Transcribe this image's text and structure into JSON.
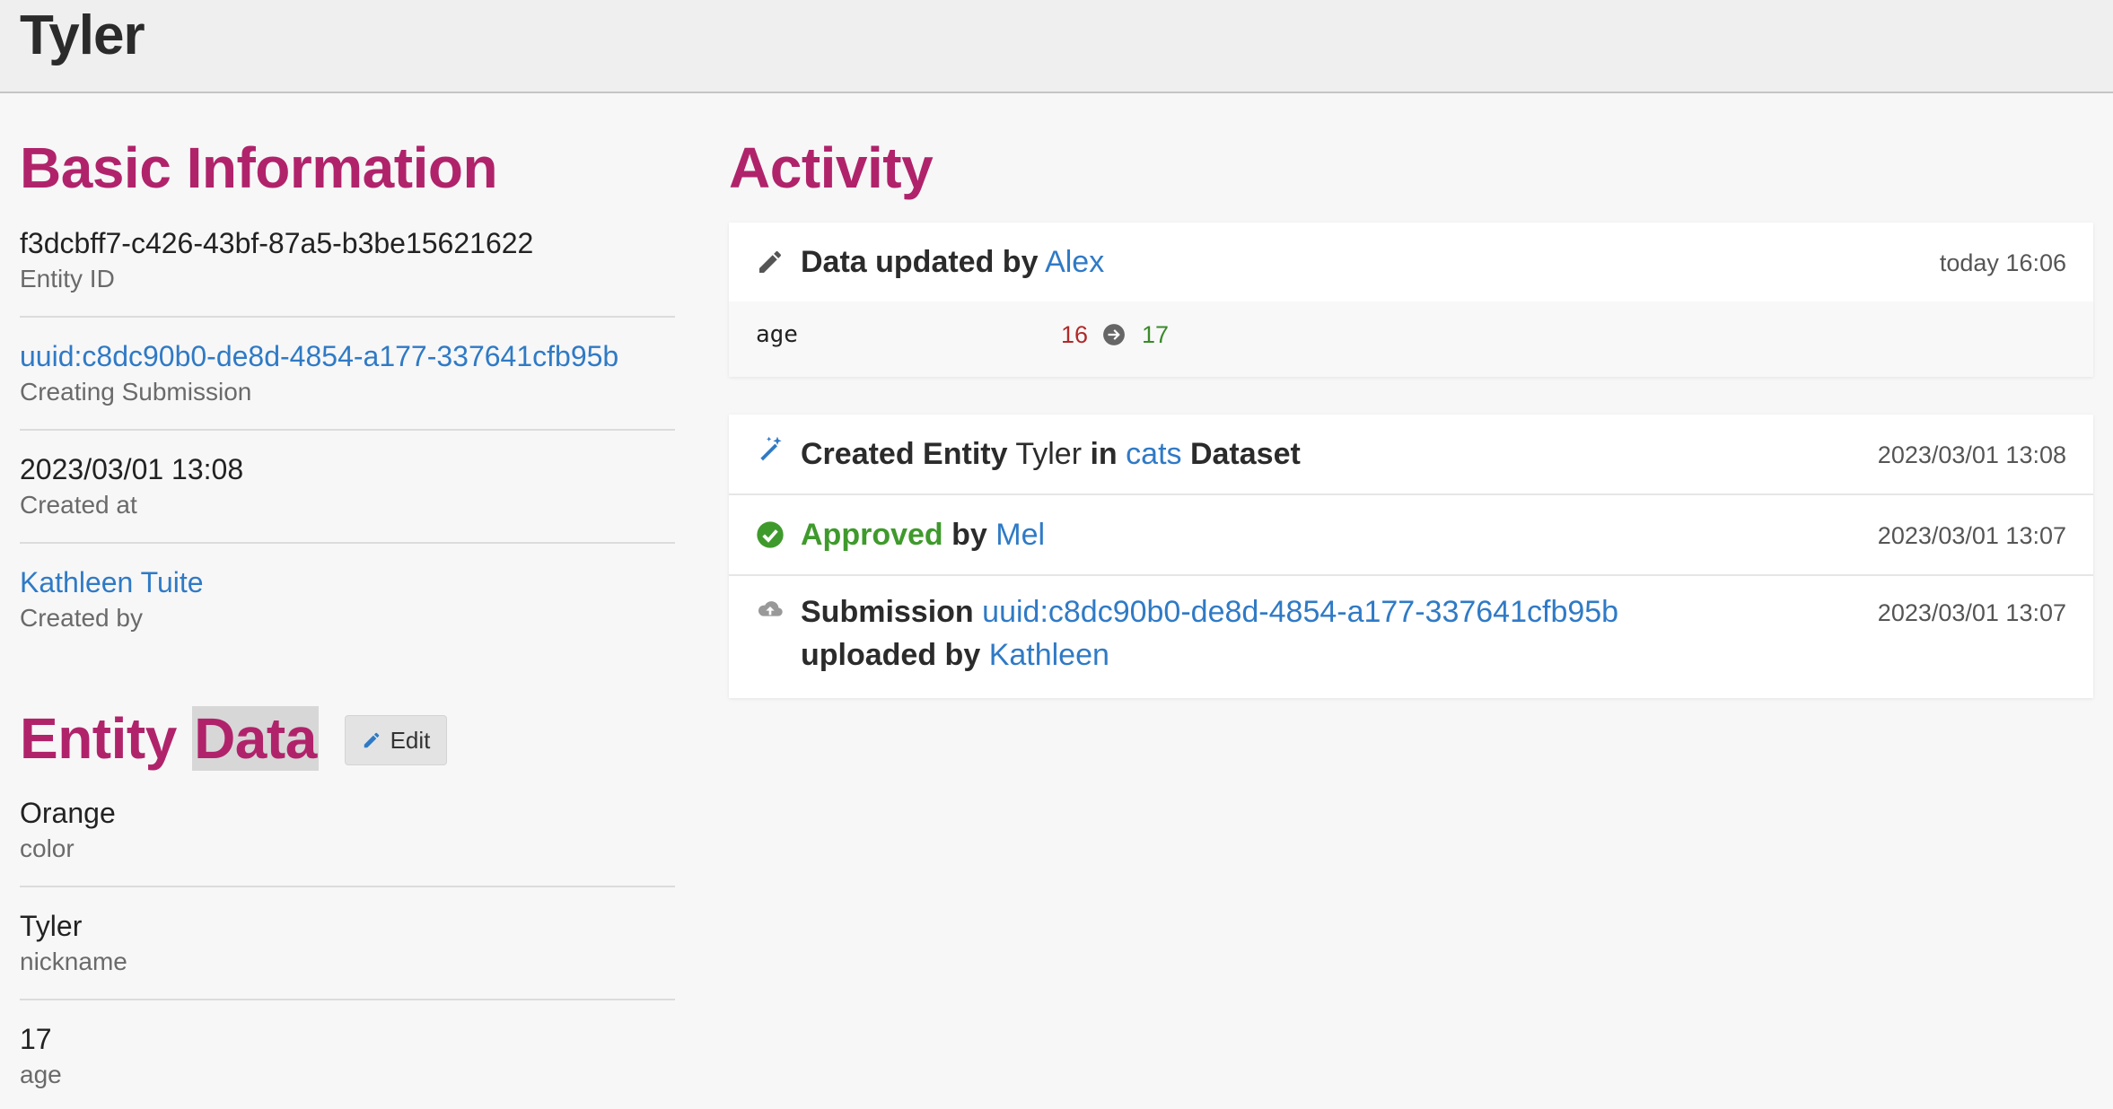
{
  "header": {
    "title": "Tyler"
  },
  "basic_info": {
    "title": "Basic Information",
    "fields": [
      {
        "value": "f3dcbff7-c426-43bf-87a5-b3be15621622",
        "label": "Entity ID"
      },
      {
        "value": "uuid:c8dc90b0-de8d-4854-a177-337641cfb95b",
        "label": "Creating Submission"
      },
      {
        "value": "2023/03/01 13:08",
        "label": "Created at"
      },
      {
        "value": "Kathleen Tuite",
        "label": "Created by"
      }
    ]
  },
  "entity_data": {
    "title_part1": "Entity",
    "title_part2": "Data",
    "edit_label": "Edit",
    "fields": [
      {
        "value": "Orange",
        "label": "color"
      },
      {
        "value": "Tyler",
        "label": "nickname"
      },
      {
        "value": "17",
        "label": "age"
      }
    ]
  },
  "activity": {
    "title": "Activity",
    "update": {
      "prefix": "Data updated by",
      "user": "Alex",
      "time": "today 16:06",
      "diff": {
        "key": "age",
        "old": "16",
        "new": "17"
      }
    },
    "created": {
      "prefix": "Created Entity",
      "entity": "Tyler",
      "in": "in",
      "dataset": "cats",
      "suffix": "Dataset",
      "time": "2023/03/01 13:08"
    },
    "approved": {
      "status": "Approved",
      "by": "by",
      "user": "Mel",
      "time": "2023/03/01 13:07"
    },
    "submission": {
      "prefix": "Submission",
      "id": "uuid:c8dc90b0-de8d-4854-a177-337641cfb95b",
      "uploaded": "uploaded by",
      "user": "Kathleen",
      "time": "2023/03/01 13:07"
    }
  },
  "colors": {
    "accent": "#b0236b",
    "link": "#2f7ac6",
    "success": "#3f9a2c",
    "removed": "#b02a2a"
  }
}
